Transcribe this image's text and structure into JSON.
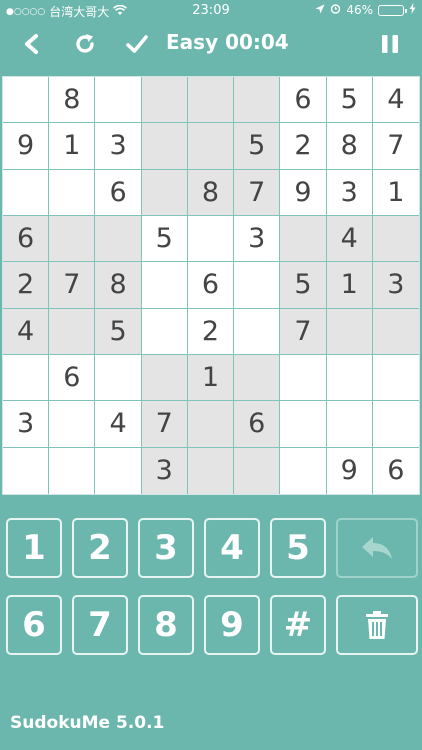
{
  "status_bar": {
    "signal": "●○○○○",
    "carrier": "台湾大哥大",
    "time": "23:09",
    "battery": "46%",
    "battery_level": 0.46
  },
  "toolbar": {
    "title": "Easy 00:04",
    "icons": [
      "back-chevron-icon",
      "refresh-icon",
      "check-icon",
      "pause-icon"
    ]
  },
  "board": {
    "rows": [
      [
        "",
        "8",
        "",
        "",
        "",
        "",
        "6",
        "5",
        "4"
      ],
      [
        "9",
        "1",
        "3",
        "",
        "",
        "5",
        "2",
        "8",
        "7"
      ],
      [
        "",
        "",
        "6",
        "",
        "8",
        "7",
        "9",
        "3",
        "1"
      ],
      [
        "6",
        "",
        "",
        "5",
        "",
        "3",
        "",
        "4",
        ""
      ],
      [
        "2",
        "7",
        "8",
        "",
        "6",
        "",
        "5",
        "1",
        "3"
      ],
      [
        "4",
        "",
        "5",
        "",
        "2",
        "",
        "7",
        "",
        ""
      ],
      [
        "",
        "6",
        "",
        "",
        "1",
        "",
        "",
        "",
        ""
      ],
      [
        "3",
        "",
        "4",
        "7",
        "",
        "6",
        "",
        "",
        ""
      ],
      [
        "",
        "",
        "",
        "3",
        "",
        "",
        "",
        "9",
        "6"
      ]
    ]
  },
  "keypad": {
    "row1": [
      "1",
      "2",
      "3",
      "4",
      "5"
    ],
    "row2": [
      "6",
      "7",
      "8",
      "9",
      "#"
    ],
    "undo_icon": "undo-arrow-icon",
    "delete_icon": "trash-icon"
  },
  "footer": {
    "app_version": "SudokuMe 5.0.1"
  },
  "colors": {
    "background": "#6bb7ad",
    "shaded_cell": "#e4e4e4",
    "digit": "#444444"
  }
}
